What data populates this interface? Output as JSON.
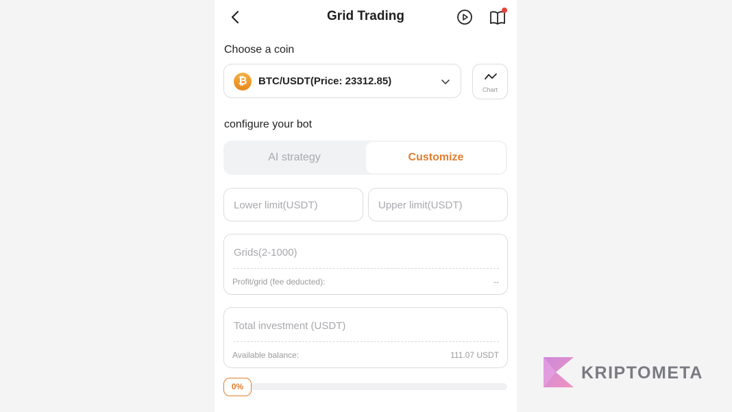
{
  "header": {
    "title": "Grid Trading"
  },
  "coin_section": {
    "label": "Choose a coin",
    "coin_symbol": "₿",
    "selected": "BTC/USDT(Price: 23312.85)",
    "chart_label": "Chart"
  },
  "configure": {
    "label": "configure your bot",
    "tabs": [
      "AI strategy",
      "Customize"
    ],
    "active_tab": "Customize"
  },
  "form": {
    "lower_limit_placeholder": "Lower limit(USDT)",
    "upper_limit_placeholder": "Upper limit(USDT)",
    "grids_placeholder": "Grids(2-1000)",
    "profit_label": "Profit/grid (fee deducted):",
    "profit_value": "--",
    "investment_placeholder": "Total investment (USDT)",
    "balance_label": "Available balance:",
    "balance_value": "111.07 USDT",
    "percent": "0%"
  },
  "watermark": {
    "brand": "KRIPTOMETA"
  },
  "colors": {
    "accent": "#e07d2e",
    "coin": "#f0a030",
    "notification_dot": "#e8413d"
  }
}
